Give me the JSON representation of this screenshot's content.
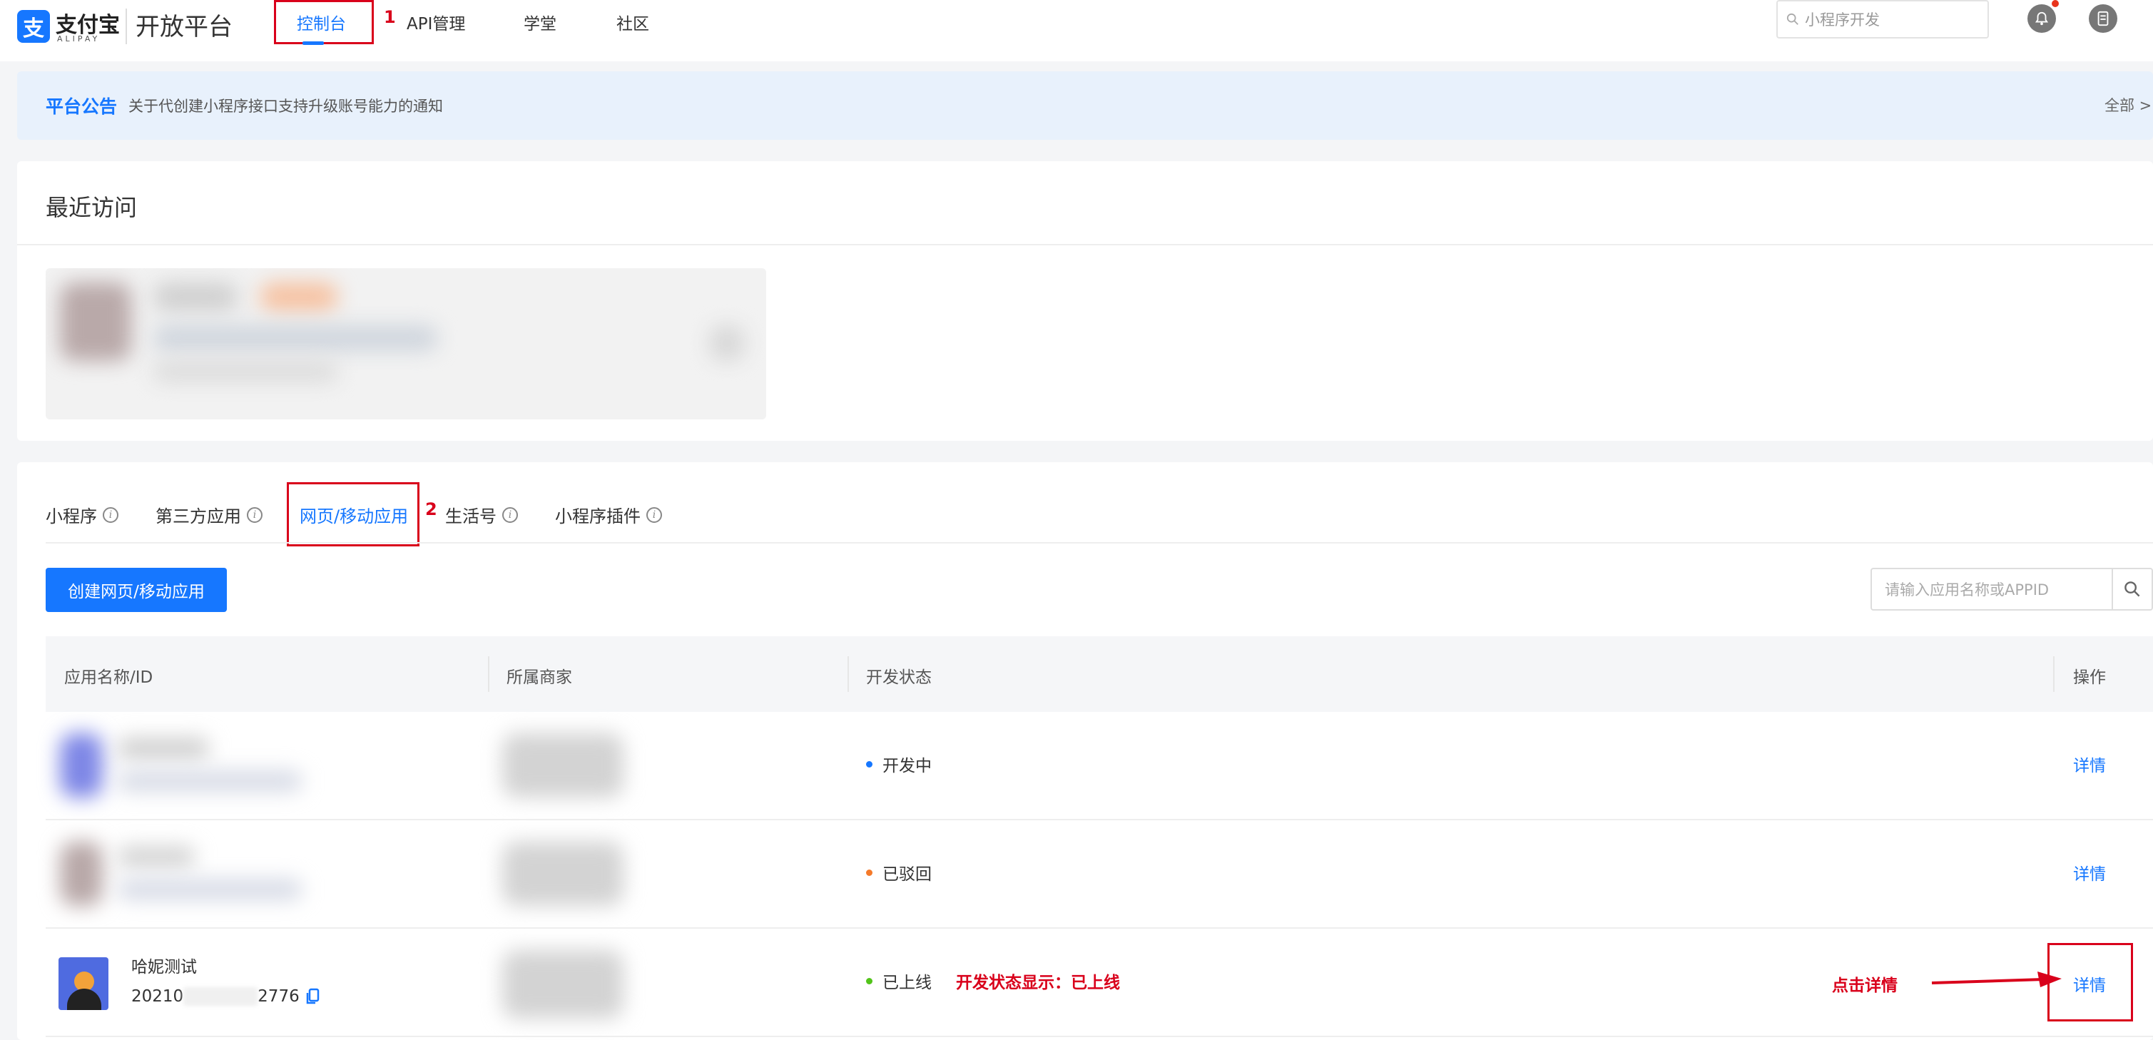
{
  "header": {
    "logo_icon": "alipay-logo-icon",
    "logo_text": "支付宝",
    "logo_sub": "ALIPAY",
    "platform_title": "开放平台",
    "nav": [
      {
        "label": "控制台",
        "number": "1"
      },
      {
        "label": "API管理"
      },
      {
        "label": "学堂"
      },
      {
        "label": "社区"
      }
    ],
    "search_placeholder": "小程序开发",
    "icons": [
      "bell-icon",
      "document-icon"
    ]
  },
  "notice": {
    "title": "平台公告",
    "text": "关于代创建小程序接口支持升级账号能力的通知",
    "all_label": "全部 >"
  },
  "recent": {
    "title": "最近访问"
  },
  "apps": {
    "tabs": [
      {
        "label": "小程序"
      },
      {
        "label": "第三方应用"
      },
      {
        "label": "网页/移动应用",
        "number": "2"
      },
      {
        "label": "生活号"
      },
      {
        "label": "小程序插件"
      }
    ],
    "create_button": "创建网页/移动应用",
    "search_placeholder": "请输入应用名称或APPID",
    "columns": [
      "应用名称/ID",
      "所属商家",
      "开发状态",
      "操作"
    ],
    "rows": [
      {
        "status": "开发中",
        "status_color": "#1677ff",
        "action": "详情"
      },
      {
        "status": "已驳回",
        "status_color": "#f57a2a",
        "action": "详情"
      },
      {
        "name": "哈妮测试",
        "id_prefix": "20210",
        "id_suffix": "2776",
        "status": "已上线",
        "status_color": "#52c41a",
        "action": "详情"
      }
    ],
    "annotation_status": "开发状态显示：已上线",
    "annotation_click": "点击详情"
  },
  "colors": {
    "brand": "#1677ff",
    "annotation": "#d9001b"
  }
}
